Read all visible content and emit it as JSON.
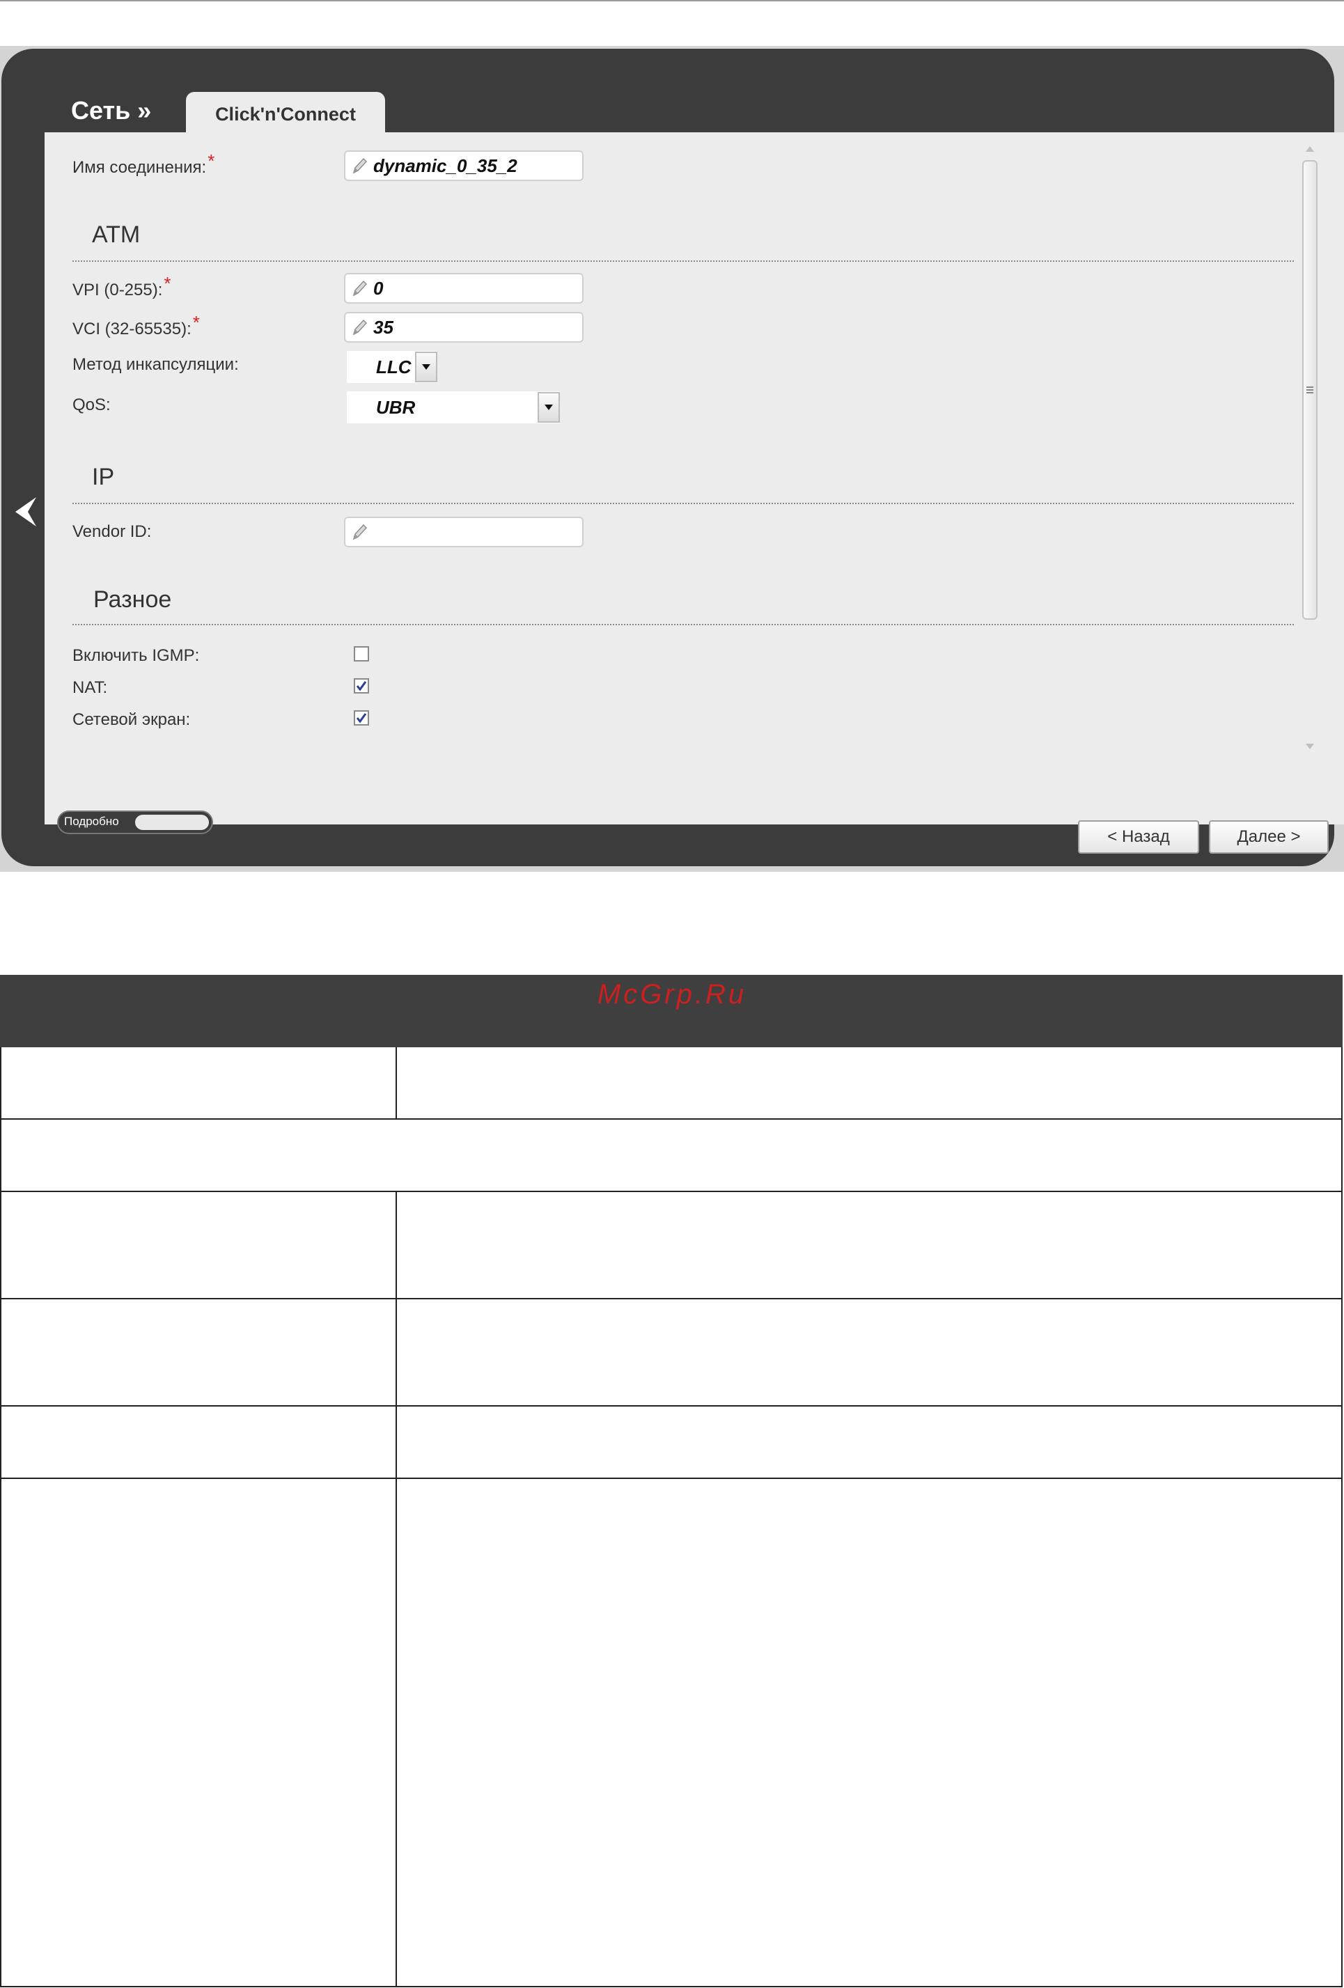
{
  "breadcrumb": {
    "section": "Сеть »",
    "active_tab": "Click'n'Connect"
  },
  "form": {
    "connection_name": {
      "label": "Имя соединения:",
      "required_mark": "*",
      "value": "dynamic_0_35_2"
    },
    "atm": {
      "title": "ATM",
      "vpi": {
        "label": "VPI (0-255):",
        "required_mark": "*",
        "value": "0"
      },
      "vci": {
        "label": "VCI (32-65535):",
        "required_mark": "*",
        "value": "35"
      },
      "encapsulation": {
        "label": "Метод инкапсуляции:",
        "value": "LLC"
      },
      "qos": {
        "label": "QoS:",
        "value": "UBR"
      }
    },
    "ip": {
      "title": "IP",
      "vendor_id": {
        "label": "Vendor ID:",
        "value": ""
      }
    },
    "misc": {
      "title": "Разное",
      "igmp": {
        "label": "Включить IGMP:",
        "checked": false
      },
      "nat": {
        "label": "NAT:",
        "checked": true
      },
      "firewall": {
        "label": "Сетевой экран:",
        "checked": true
      }
    }
  },
  "footer": {
    "details_toggle": "Подробно",
    "back_button": "< Назад",
    "next_button": "Далее >"
  },
  "watermark": "McGrp.Ru",
  "icons": {
    "back": "chevron-left-icon",
    "edit": "pencil-icon",
    "dropdown": "triangle-down-icon",
    "check": "check-icon",
    "scroll_grip": "grip-icon"
  },
  "colors": {
    "dark_bg": "#3c3c3c",
    "panel_bg": "#ececec",
    "required": "#e02020",
    "watermark": "#cc1f1f"
  }
}
